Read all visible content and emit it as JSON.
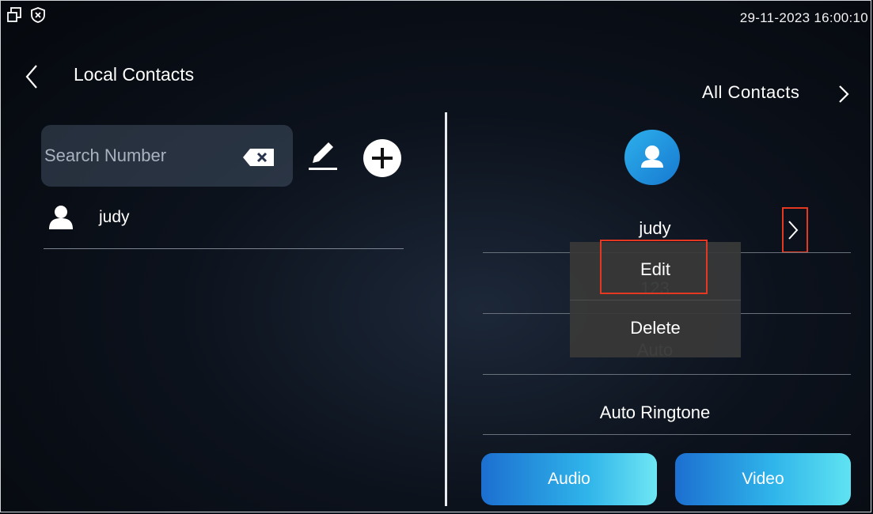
{
  "status_bar": {
    "datetime": "29-11-2023 16:00:10",
    "icons": [
      "window-restore-icon",
      "security-shield-icon"
    ]
  },
  "header": {
    "title": "Local Contacts",
    "back_icon": "chevron-left-icon",
    "all_contacts_label": "All Contacts"
  },
  "search": {
    "placeholder": "Search Number"
  },
  "contacts": [
    {
      "name": "judy",
      "icon": "person-icon"
    }
  ],
  "detail": {
    "name": "judy",
    "number": "123",
    "mode": "Auto",
    "ringtone": "Auto Ringtone"
  },
  "context_menu": {
    "edit_label": "Edit",
    "delete_label": "Delete"
  },
  "actions": {
    "audio_label": "Audio",
    "video_label": "Video"
  },
  "colors": {
    "highlight": "#e53821",
    "accent": "#2fb4ea"
  }
}
